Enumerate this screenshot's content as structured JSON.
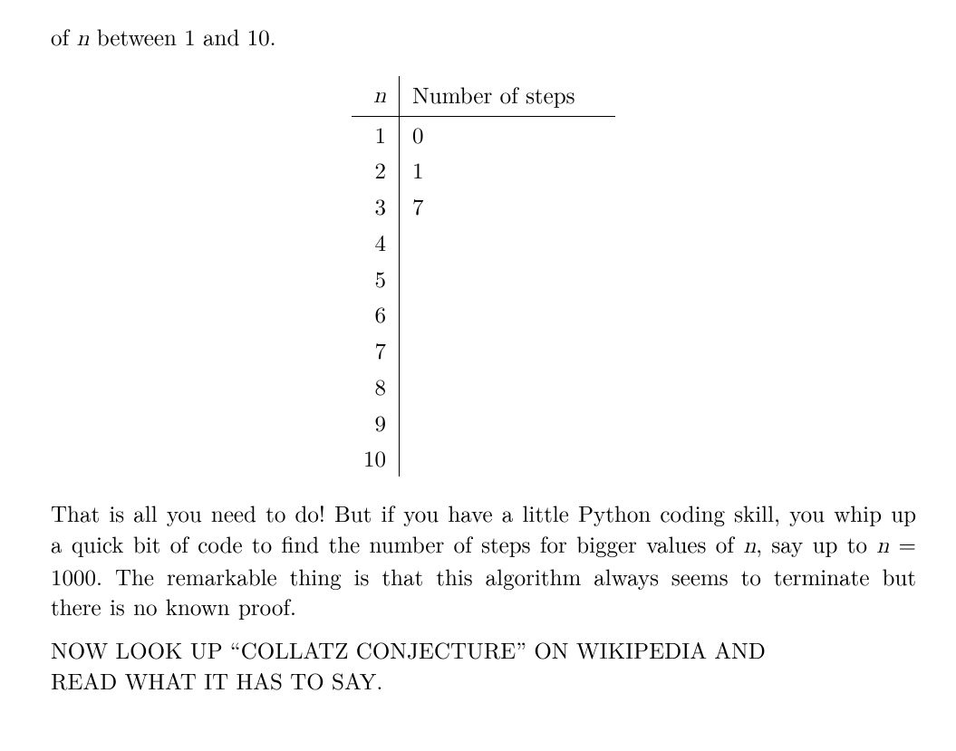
{
  "top_line_prefix": "of ",
  "top_line_var": "n",
  "top_line_suffix": " between 1 and 10.",
  "table": {
    "header_n": "n",
    "header_steps": "Number of steps",
    "rows": [
      {
        "n": "1",
        "steps": "0"
      },
      {
        "n": "2",
        "steps": "1"
      },
      {
        "n": "3",
        "steps": "7"
      },
      {
        "n": "4",
        "steps": ""
      },
      {
        "n": "5",
        "steps": ""
      },
      {
        "n": "6",
        "steps": ""
      },
      {
        "n": "7",
        "steps": ""
      },
      {
        "n": "8",
        "steps": ""
      },
      {
        "n": "9",
        "steps": ""
      },
      {
        "n": "10",
        "steps": ""
      }
    ]
  },
  "body": {
    "seg1": "That is all you need to do! But if you have a little Python coding skill, you whip up a quick bit of code to find the number of steps for bigger values of ",
    "var1": "n",
    "seg2": ", say up to ",
    "var2": "n",
    "seg3": " = 1000. The remarkable thing is that this algorithm always seems to terminate but there is no known proof."
  },
  "directive": {
    "line1": "NOW LOOK UP “COLLATZ CONJECTURE” ON WIKIPEDIA AND",
    "line2": "READ WHAT IT HAS TO SAY."
  }
}
